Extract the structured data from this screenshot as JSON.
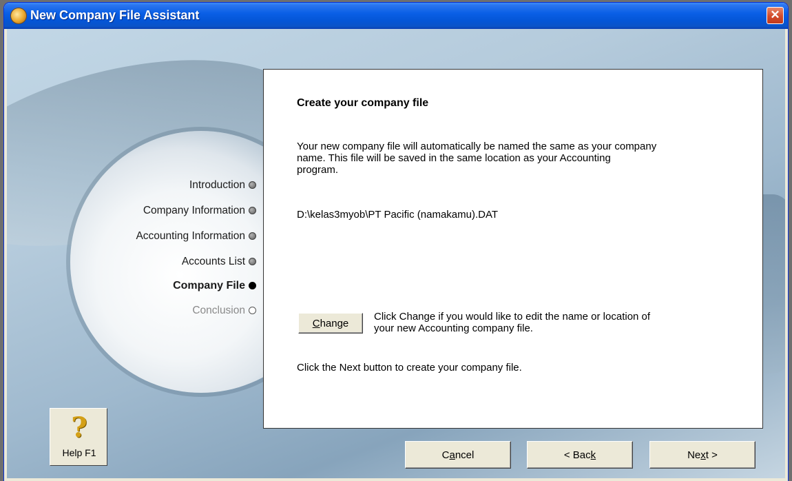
{
  "window": {
    "title": "New Company File Assistant",
    "close_label": "✕"
  },
  "steps": [
    {
      "label": "Introduction",
      "state": "done"
    },
    {
      "label": "Company Information",
      "state": "done"
    },
    {
      "label": "Accounting Information",
      "state": "done"
    },
    {
      "label": "Accounts List",
      "state": "done"
    },
    {
      "label": "Company File",
      "state": "current"
    },
    {
      "label": "Conclusion",
      "state": "future"
    }
  ],
  "panel": {
    "heading": "Create your company file",
    "description_line1": "Your new company file will automatically be named the same as your company",
    "description_line2": "name.  This file will be saved in the same location as your Accounting",
    "description_line3": "program.",
    "file_path": "D:\\kelas3myob\\PT Pacific (namakamu).DAT",
    "change_hint_line1": "Click Change if you would like to edit the name or location of",
    "change_hint_line2": "your new Accounting company file.",
    "next_hint": "Click the Next button to create your company file."
  },
  "buttons": {
    "change": {
      "pre": "",
      "mnemonic": "C",
      "post": "hange"
    },
    "help": {
      "icon": "?",
      "label": "Help F1"
    },
    "cancel": {
      "pre": "C",
      "mnemonic": "a",
      "post": "ncel"
    },
    "back": {
      "pre": "< Bac",
      "mnemonic": "k",
      "post": ""
    },
    "next": {
      "pre": "Ne",
      "mnemonic": "x",
      "post": "t >"
    }
  },
  "colors": {
    "titlebar": "#0a5fe6",
    "close": "#d24b2b",
    "button_face": "#ece9d8"
  }
}
